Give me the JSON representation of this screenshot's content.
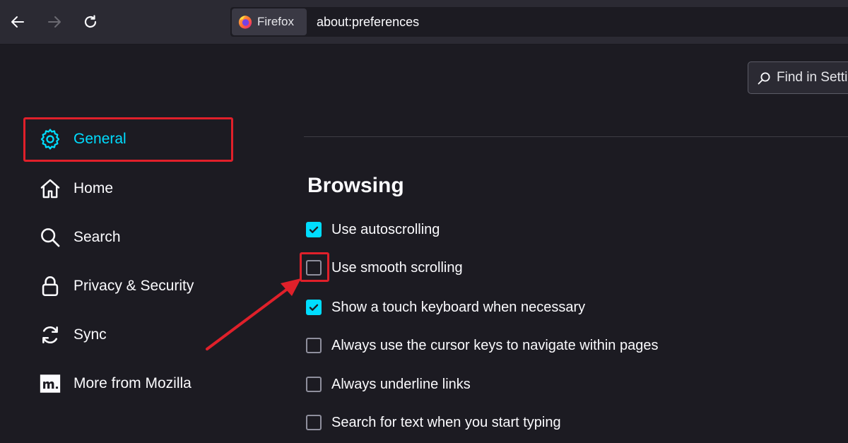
{
  "toolbar": {
    "identity_label": "Firefox",
    "url": "about:preferences"
  },
  "search": {
    "placeholder": "Find in Settings"
  },
  "sidebar": {
    "items": [
      {
        "label": "General",
        "icon": "gear-icon",
        "selected": true
      },
      {
        "label": "Home",
        "icon": "home-icon"
      },
      {
        "label": "Search",
        "icon": "search-icon"
      },
      {
        "label": "Privacy & Security",
        "icon": "lock-icon"
      },
      {
        "label": "Sync",
        "icon": "sync-icon"
      },
      {
        "label": "More from Mozilla",
        "icon": "mozilla-icon"
      }
    ]
  },
  "browsing": {
    "title": "Browsing",
    "options": [
      {
        "label": "Use autoscrolling",
        "checked": true
      },
      {
        "label": "Use smooth scrolling",
        "checked": false
      },
      {
        "label": "Show a touch keyboard when necessary",
        "checked": true
      },
      {
        "label": "Always use the cursor keys to navigate within pages",
        "checked": false
      },
      {
        "label": "Always underline links",
        "checked": false
      },
      {
        "label": "Search for text when you start typing",
        "checked": false
      }
    ]
  },
  "colors": {
    "accent": "#00ddff",
    "annotation": "#e0202a",
    "background": "#1c1b22"
  }
}
